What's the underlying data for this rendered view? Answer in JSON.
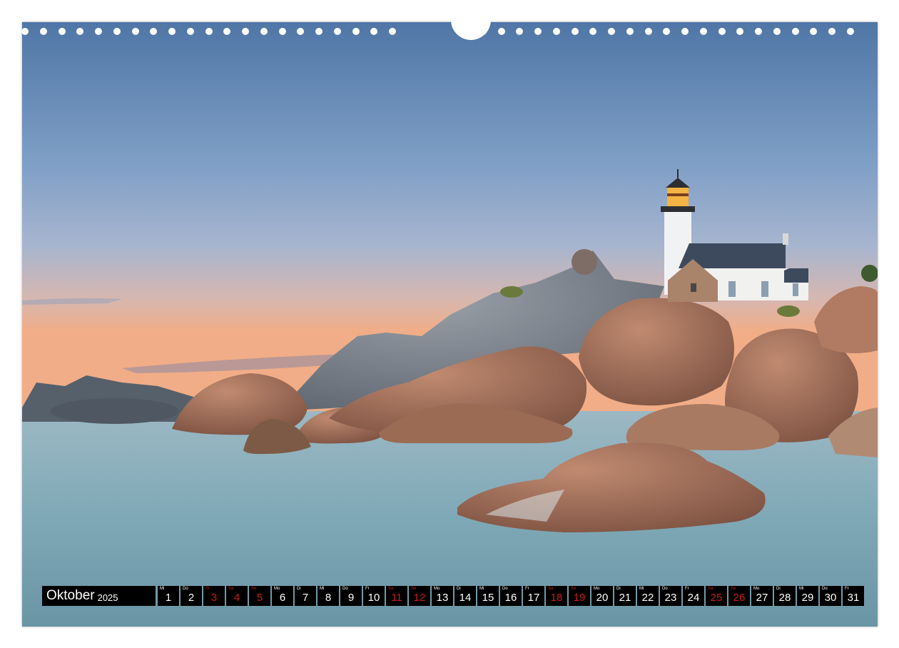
{
  "calendar": {
    "month": "Oktober",
    "year": "2025",
    "days": [
      {
        "num": "1",
        "weekday": "Mi",
        "weekend": false
      },
      {
        "num": "2",
        "weekday": "Do",
        "weekend": false
      },
      {
        "num": "3",
        "weekday": "Fr",
        "weekend": true
      },
      {
        "num": "4",
        "weekday": "Sa",
        "weekend": true
      },
      {
        "num": "5",
        "weekday": "So",
        "weekend": true
      },
      {
        "num": "6",
        "weekday": "Mo",
        "weekend": false
      },
      {
        "num": "7",
        "weekday": "Di",
        "weekend": false
      },
      {
        "num": "8",
        "weekday": "Mi",
        "weekend": false
      },
      {
        "num": "9",
        "weekday": "Do",
        "weekend": false
      },
      {
        "num": "10",
        "weekday": "Fr",
        "weekend": false
      },
      {
        "num": "11",
        "weekday": "Sa",
        "weekend": true
      },
      {
        "num": "12",
        "weekday": "So",
        "weekend": true
      },
      {
        "num": "13",
        "weekday": "Mo",
        "weekend": false
      },
      {
        "num": "14",
        "weekday": "Di",
        "weekend": false
      },
      {
        "num": "15",
        "weekday": "Mi",
        "weekend": false
      },
      {
        "num": "16",
        "weekday": "Do",
        "weekend": false
      },
      {
        "num": "17",
        "weekday": "Fr",
        "weekend": false
      },
      {
        "num": "18",
        "weekday": "Sa",
        "weekend": true
      },
      {
        "num": "19",
        "weekday": "So",
        "weekend": true
      },
      {
        "num": "20",
        "weekday": "Mo",
        "weekend": false
      },
      {
        "num": "21",
        "weekday": "Di",
        "weekend": false
      },
      {
        "num": "22",
        "weekday": "Mi",
        "weekend": false
      },
      {
        "num": "23",
        "weekday": "Do",
        "weekend": false
      },
      {
        "num": "24",
        "weekday": "Fr",
        "weekend": false
      },
      {
        "num": "25",
        "weekday": "Sa",
        "weekend": true
      },
      {
        "num": "26",
        "weekday": "So",
        "weekend": true
      },
      {
        "num": "27",
        "weekday": "Mo",
        "weekend": false
      },
      {
        "num": "28",
        "weekday": "Di",
        "weekend": false
      },
      {
        "num": "29",
        "weekday": "Mi",
        "weekend": false
      },
      {
        "num": "30",
        "weekday": "Do",
        "weekend": false
      },
      {
        "num": "31",
        "weekday": "Fr",
        "weekend": false
      }
    ]
  },
  "colors": {
    "weekend": "#cc1b1b",
    "bar": "#000000",
    "sky_top": "#5b7fad",
    "sky_horizon": "#f3b28a",
    "water": "#8fb7c4",
    "rock": "#a8705a"
  },
  "photo": {
    "subject": "lighthouse-on-granite-rocks-icon"
  }
}
